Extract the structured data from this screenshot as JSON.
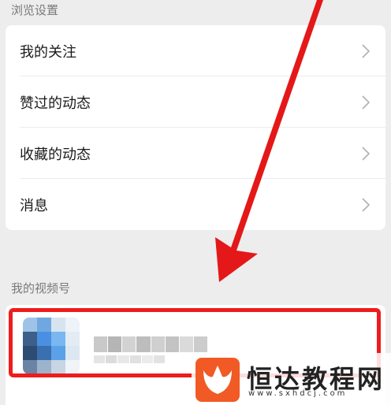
{
  "browse_section": {
    "title": "浏览设置",
    "items": [
      {
        "label": "我的关注"
      },
      {
        "label": "赞过的动态"
      },
      {
        "label": "收藏的动态"
      },
      {
        "label": "消息"
      }
    ]
  },
  "channel_section": {
    "title": "我的视频号"
  },
  "watermark": {
    "brand": "恒达教程网",
    "url": "www.sxhdcj.com"
  },
  "colors": {
    "highlight": "#ee1c1c",
    "background": "#ededed",
    "card": "#ffffff"
  },
  "icons": [
    "chevron-right-icon",
    "red-arrow-annotation",
    "brand-logo-icon"
  ]
}
